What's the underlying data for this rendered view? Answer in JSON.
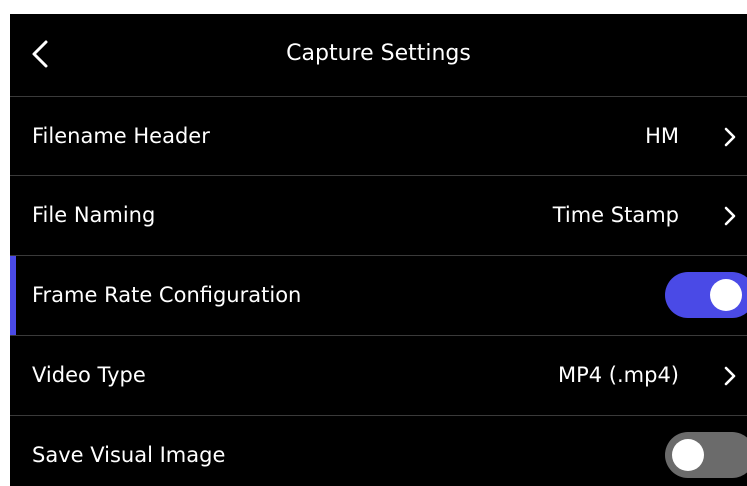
{
  "header": {
    "title": "Capture Settings",
    "back_icon": "chevron-left-icon"
  },
  "colors": {
    "background": "#000000",
    "accent": "#4a4ae6",
    "toggle_off": "#6b6b6b",
    "divider": "#3a3a3a",
    "text": "#ffffff"
  },
  "settings": {
    "filename_header": {
      "label": "Filename Header",
      "value": "HM",
      "icon": "chevron-right-icon"
    },
    "file_naming": {
      "label": "File Naming",
      "value": "Time Stamp",
      "icon": "chevron-right-icon"
    },
    "frame_rate": {
      "label": "Frame Rate Configuration",
      "enabled": true,
      "selected": true
    },
    "video_type": {
      "label": "Video Type",
      "value": "MP4 (.mp4)",
      "icon": "chevron-right-icon"
    },
    "save_visual": {
      "label": "Save Visual Image",
      "enabled": false
    }
  }
}
